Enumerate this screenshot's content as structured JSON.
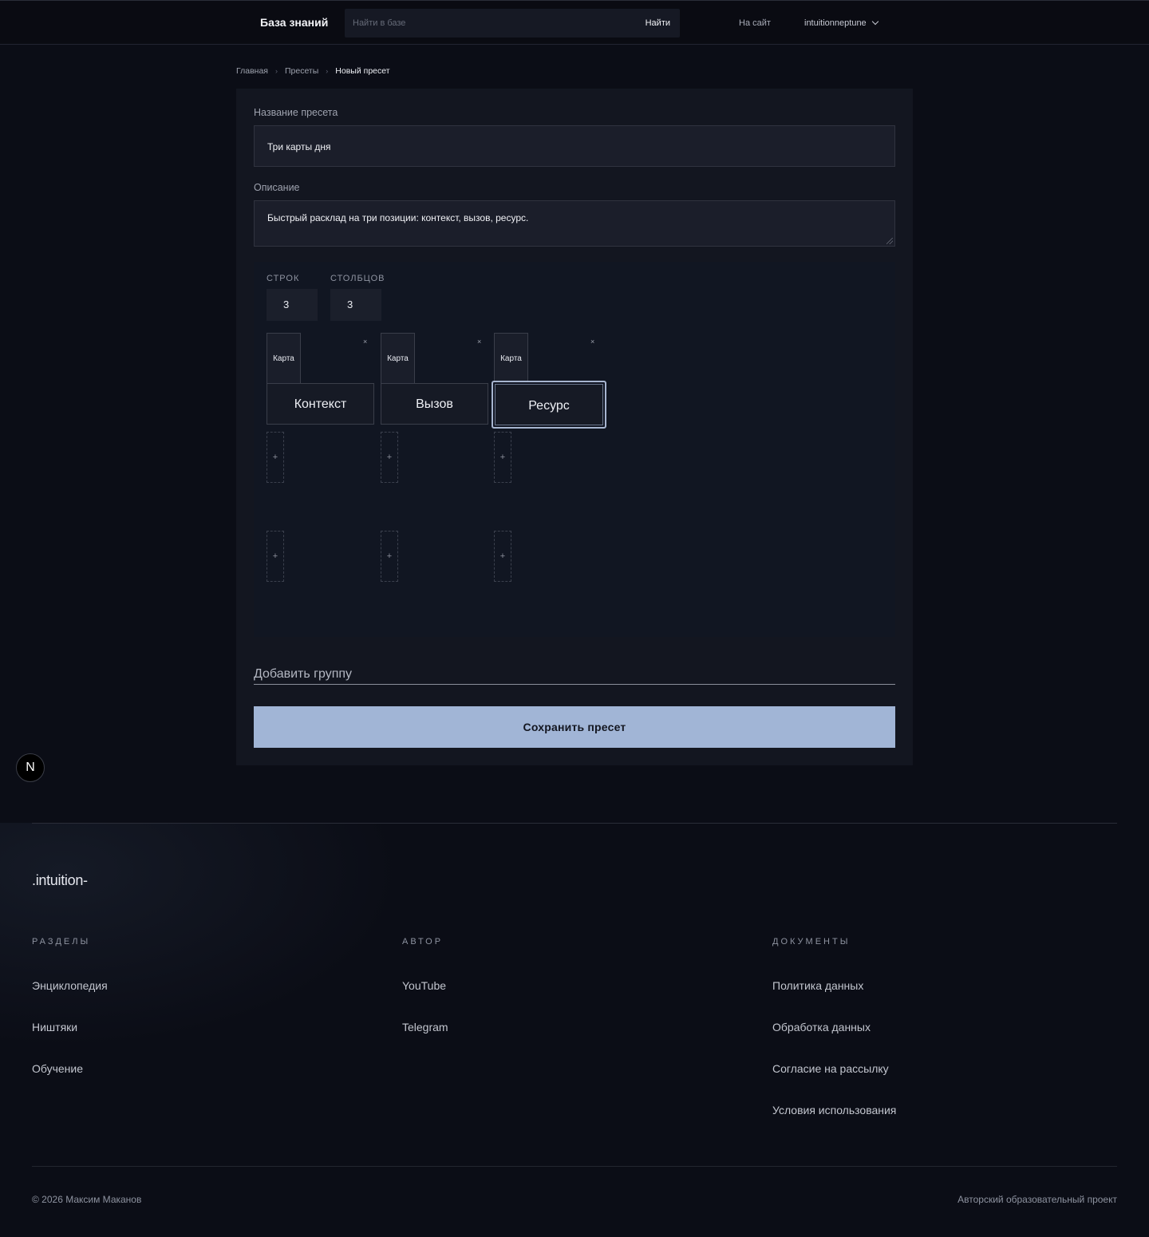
{
  "header": {
    "brand": "База знаний",
    "search_placeholder": "Найти в базе",
    "search_button": "Найти",
    "site_link": "На сайт",
    "username": "intuitionneptune"
  },
  "breadcrumb": [
    "Главная",
    "Пресеты",
    "Новый пресет"
  ],
  "form": {
    "name_label": "Название пресета",
    "name_value": "Три карты дня",
    "description_label": "Описание",
    "description_value": "Быстрый расклад на три позиции: контекст, вызов, ресурс.",
    "rows_label": "СТРОК",
    "rows_value": "3",
    "cols_label": "СТОЛБЦОВ",
    "cols_value": "3",
    "columns": [
      {
        "tab": "Карта",
        "close": "×",
        "position": "Контекст",
        "active": false
      },
      {
        "tab": "Карта",
        "close": "×",
        "position": "Вызов",
        "active": false
      },
      {
        "tab": "Карта",
        "close": "×",
        "position": "Ресурс",
        "active": true
      }
    ],
    "slot_symbol": "+",
    "add_group": "Добавить группу",
    "save_button": "Сохранить пресет"
  },
  "badge": "N",
  "footer": {
    "logo": ".intuition-",
    "sections": {
      "title": "РАЗДЕЛЫ",
      "links": [
        "Энциклопедия",
        "Ништяки",
        "Обучение"
      ]
    },
    "author": {
      "title": "АВТОР",
      "links": [
        "YouTube",
        "Telegram"
      ]
    },
    "documents": {
      "title": "ДОКУМЕНТЫ",
      "links": [
        "Политика данных",
        "Обработка данных",
        "Согласие на рассылку",
        "Условия использования"
      ]
    },
    "copyright": "© 2026 Максим Маканов",
    "tagline": "Авторский образовательный проект"
  }
}
